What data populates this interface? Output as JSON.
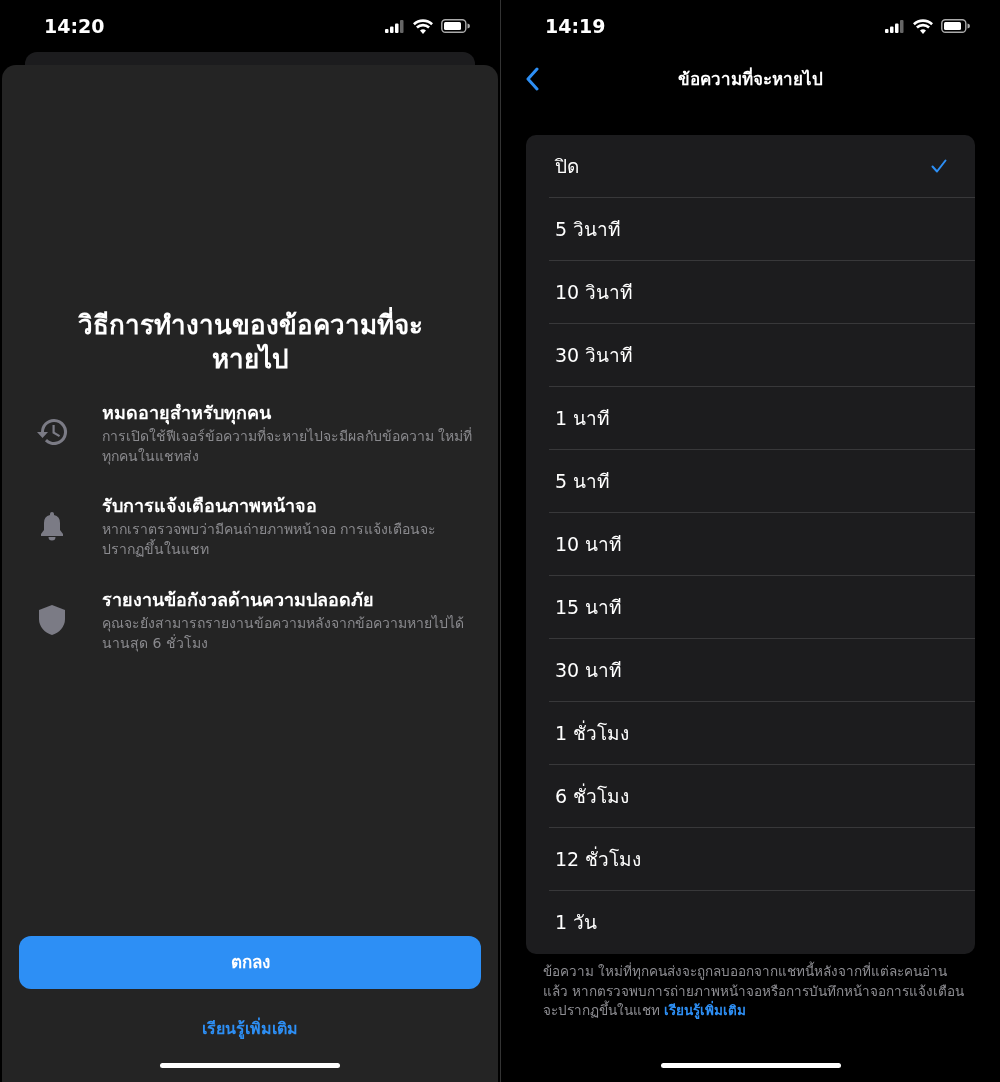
{
  "left_screen": {
    "status_time": "14:20",
    "title": "วิธีการทำงานของข้อความที่จะหายไป",
    "features": [
      {
        "title": "หมดอายุสำหรับทุกคน",
        "description": "การเปิดใช้ฟีเจอร์ข้อความที่จะหายไปจะมีผลกับข้อความ ใหม่ที่ทุกคนในแชทส่ง"
      },
      {
        "title": "รับการแจ้งเตือนภาพหน้าจอ",
        "description": "หากเราตรวจพบว่ามีคนถ่ายภาพหน้าจอ การแจ้งเตือนจะปรากฏขึ้นในแชท"
      },
      {
        "title": "รายงานข้อกังวลด้านความปลอดภัย",
        "description": "คุณจะยังสามารถรายงานข้อความหลังจากข้อความหายไปได้นานสุด 6 ชั่วโมง"
      }
    ],
    "ok_button": "ตกลง",
    "learn_more": "เรียนรู้เพิ่มเติม"
  },
  "right_screen": {
    "status_time": "14:19",
    "nav_title": "ข้อความที่จะหายไป",
    "options": [
      {
        "label": "ปิด",
        "selected": true
      },
      {
        "label": "5 วินาที",
        "selected": false
      },
      {
        "label": "10 วินาที",
        "selected": false
      },
      {
        "label": "30 วินาที",
        "selected": false
      },
      {
        "label": "1 นาที",
        "selected": false
      },
      {
        "label": "5 นาที",
        "selected": false
      },
      {
        "label": "10 นาที",
        "selected": false
      },
      {
        "label": "15 นาที",
        "selected": false
      },
      {
        "label": "30 นาที",
        "selected": false
      },
      {
        "label": "1 ชั่วโมง",
        "selected": false
      },
      {
        "label": "6 ชั่วโมง",
        "selected": false
      },
      {
        "label": "12 ชั่วโมง",
        "selected": false
      },
      {
        "label": "1 วัน",
        "selected": false
      }
    ],
    "footer": {
      "text": "ข้อความ ใหม่ที่ทุกคนส่งจะถูกลบออกจากแชทนี้หลังจากที่แต่ละคนอ่านแล้ว หากตรวจพบการถ่ายภาพหน้าจอหรือการบันทึกหน้าจอการแจ้งเตือนจะปรากฏขึ้นในแชท",
      "link": "เรียนรู้เพิ่มเติม"
    }
  }
}
